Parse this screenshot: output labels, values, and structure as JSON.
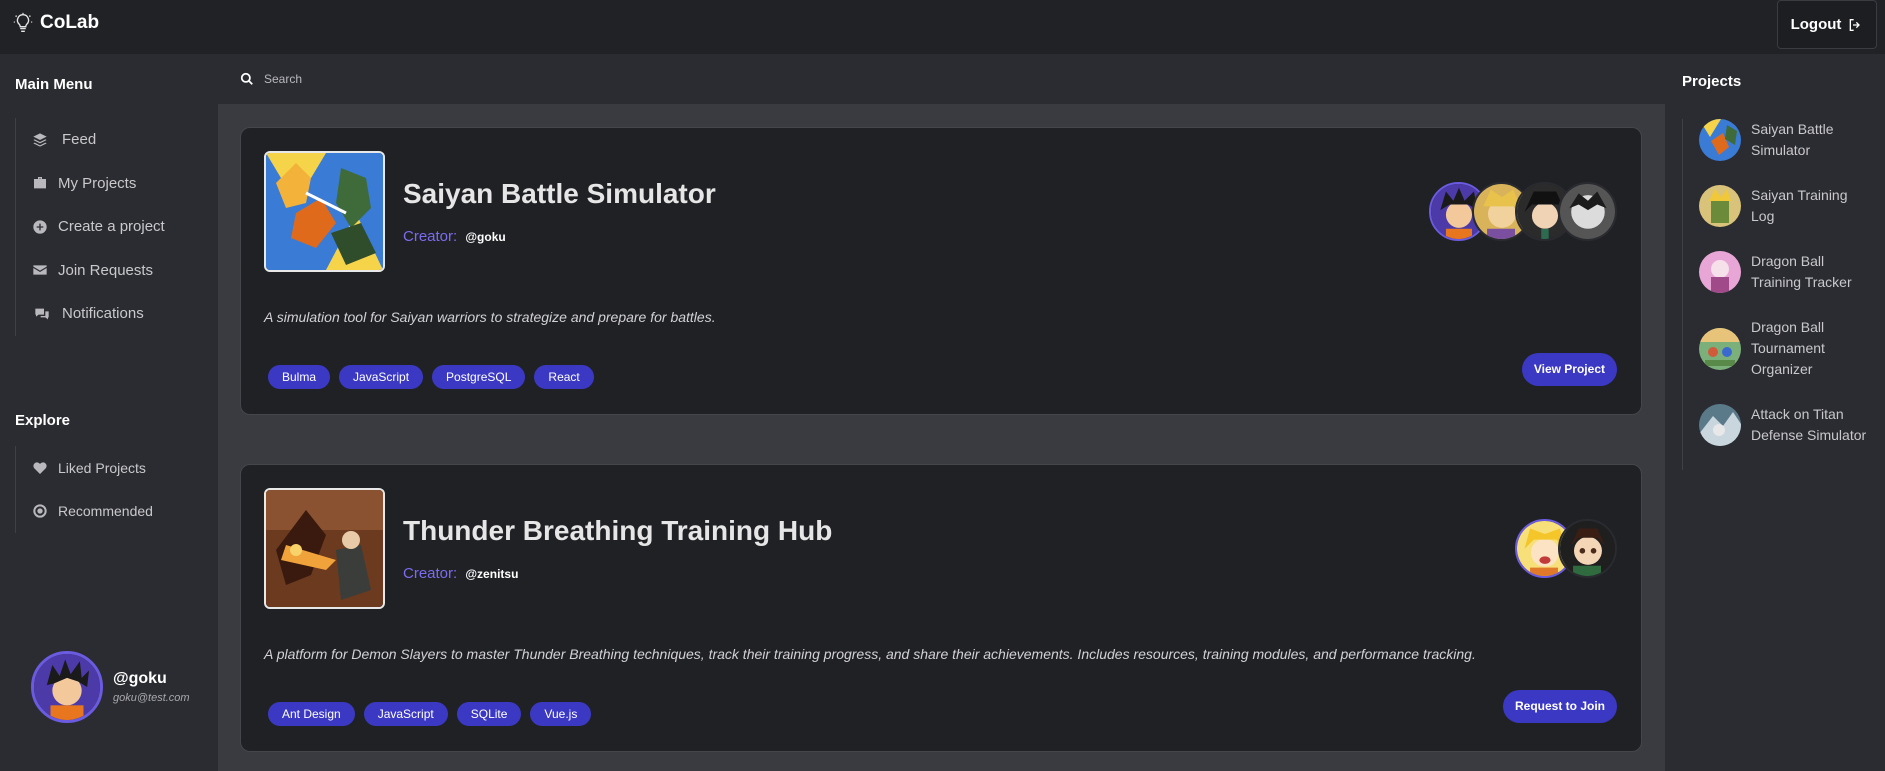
{
  "brand": {
    "name": "CoLab"
  },
  "header": {
    "logout_label": "Logout"
  },
  "sidebar": {
    "main_menu_label": "Main Menu",
    "items": [
      {
        "label": "Feed",
        "icon": "layers-icon"
      },
      {
        "label": "My Projects",
        "icon": "briefcase-icon"
      },
      {
        "label": "Create a project",
        "icon": "plus-circle-icon"
      },
      {
        "label": "Join Requests",
        "icon": "envelope-icon"
      },
      {
        "label": "Notifications",
        "icon": "comments-icon"
      }
    ],
    "explore_label": "Explore",
    "explore_items": [
      {
        "label": "Liked Projects",
        "icon": "heart-icon"
      },
      {
        "label": "Recommended",
        "icon": "target-icon"
      }
    ]
  },
  "user": {
    "handle": "@goku",
    "email": "goku@test.com"
  },
  "search": {
    "placeholder": "Search"
  },
  "feed": [
    {
      "title": "Saiyan Battle Simulator",
      "creator_label": "Creator:",
      "creator": "@goku",
      "description": "A simulation tool for Saiyan warriors to strategize and prepare for battles.",
      "tags": [
        "Bulma",
        "JavaScript",
        "PostgreSQL",
        "React"
      ],
      "action": "View Project",
      "member_count": 4
    },
    {
      "title": "Thunder Breathing Training Hub",
      "creator_label": "Creator:",
      "creator": "@zenitsu",
      "description": "A platform for Demon Slayers to master Thunder Breathing techniques, track their training progress, and share their achievements. Includes resources, training modules, and performance tracking.",
      "tags": [
        "Ant Design",
        "JavaScript",
        "SQLite",
        "Vue.js"
      ],
      "action": "Request to Join",
      "member_count": 2
    }
  ],
  "right_panel": {
    "title": "Projects",
    "projects": [
      "Saiyan Battle Simulator",
      "Saiyan Training Log",
      "Dragon Ball Training Tracker",
      "Dragon Ball Tournament Organizer",
      "Attack on Titan Defense Simulator"
    ]
  },
  "colors": {
    "accent": "#3b39c4",
    "creator_label": "#7b6cf0",
    "avatar_ring": "#6a5be0"
  }
}
